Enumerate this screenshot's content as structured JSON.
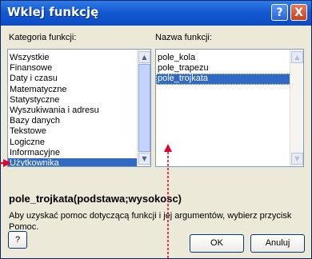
{
  "window": {
    "title": "Wklej funkcję",
    "help_glyph": "?",
    "close_glyph": "X"
  },
  "category_panel": {
    "label": "Kategoria funkcji:",
    "items": [
      {
        "label": "Wszystkie"
      },
      {
        "label": "Finansowe"
      },
      {
        "label": "Daty i czasu"
      },
      {
        "label": "Matematyczne"
      },
      {
        "label": "Statystyczne"
      },
      {
        "label": "Wyszukiwania i adresu"
      },
      {
        "label": "Bazy danych"
      },
      {
        "label": "Tekstowe"
      },
      {
        "label": "Logiczne"
      },
      {
        "label": "Informacyjne"
      },
      {
        "label": "Użytkownika"
      }
    ],
    "selected_index": 10
  },
  "function_panel": {
    "label": "Nazwa funkcji:",
    "items": [
      {
        "label": "pole_kola"
      },
      {
        "label": "pole_trapezu"
      },
      {
        "label": "pole_trojkata"
      }
    ],
    "selected_index": 2
  },
  "details": {
    "signature": "pole_trojkata(podstawa;wysokosc)",
    "description": "Aby uzyskać pomoc dotyczącą funkcji i jej argumentów, wybierz przycisk Pomoc."
  },
  "buttons": {
    "help_label": "?",
    "ok_label": "OK",
    "cancel_label": "Anuluj"
  },
  "colors": {
    "titlebar": "#1459d0",
    "selection": "#316ac5",
    "annotation_arrow": "#e0002a"
  }
}
